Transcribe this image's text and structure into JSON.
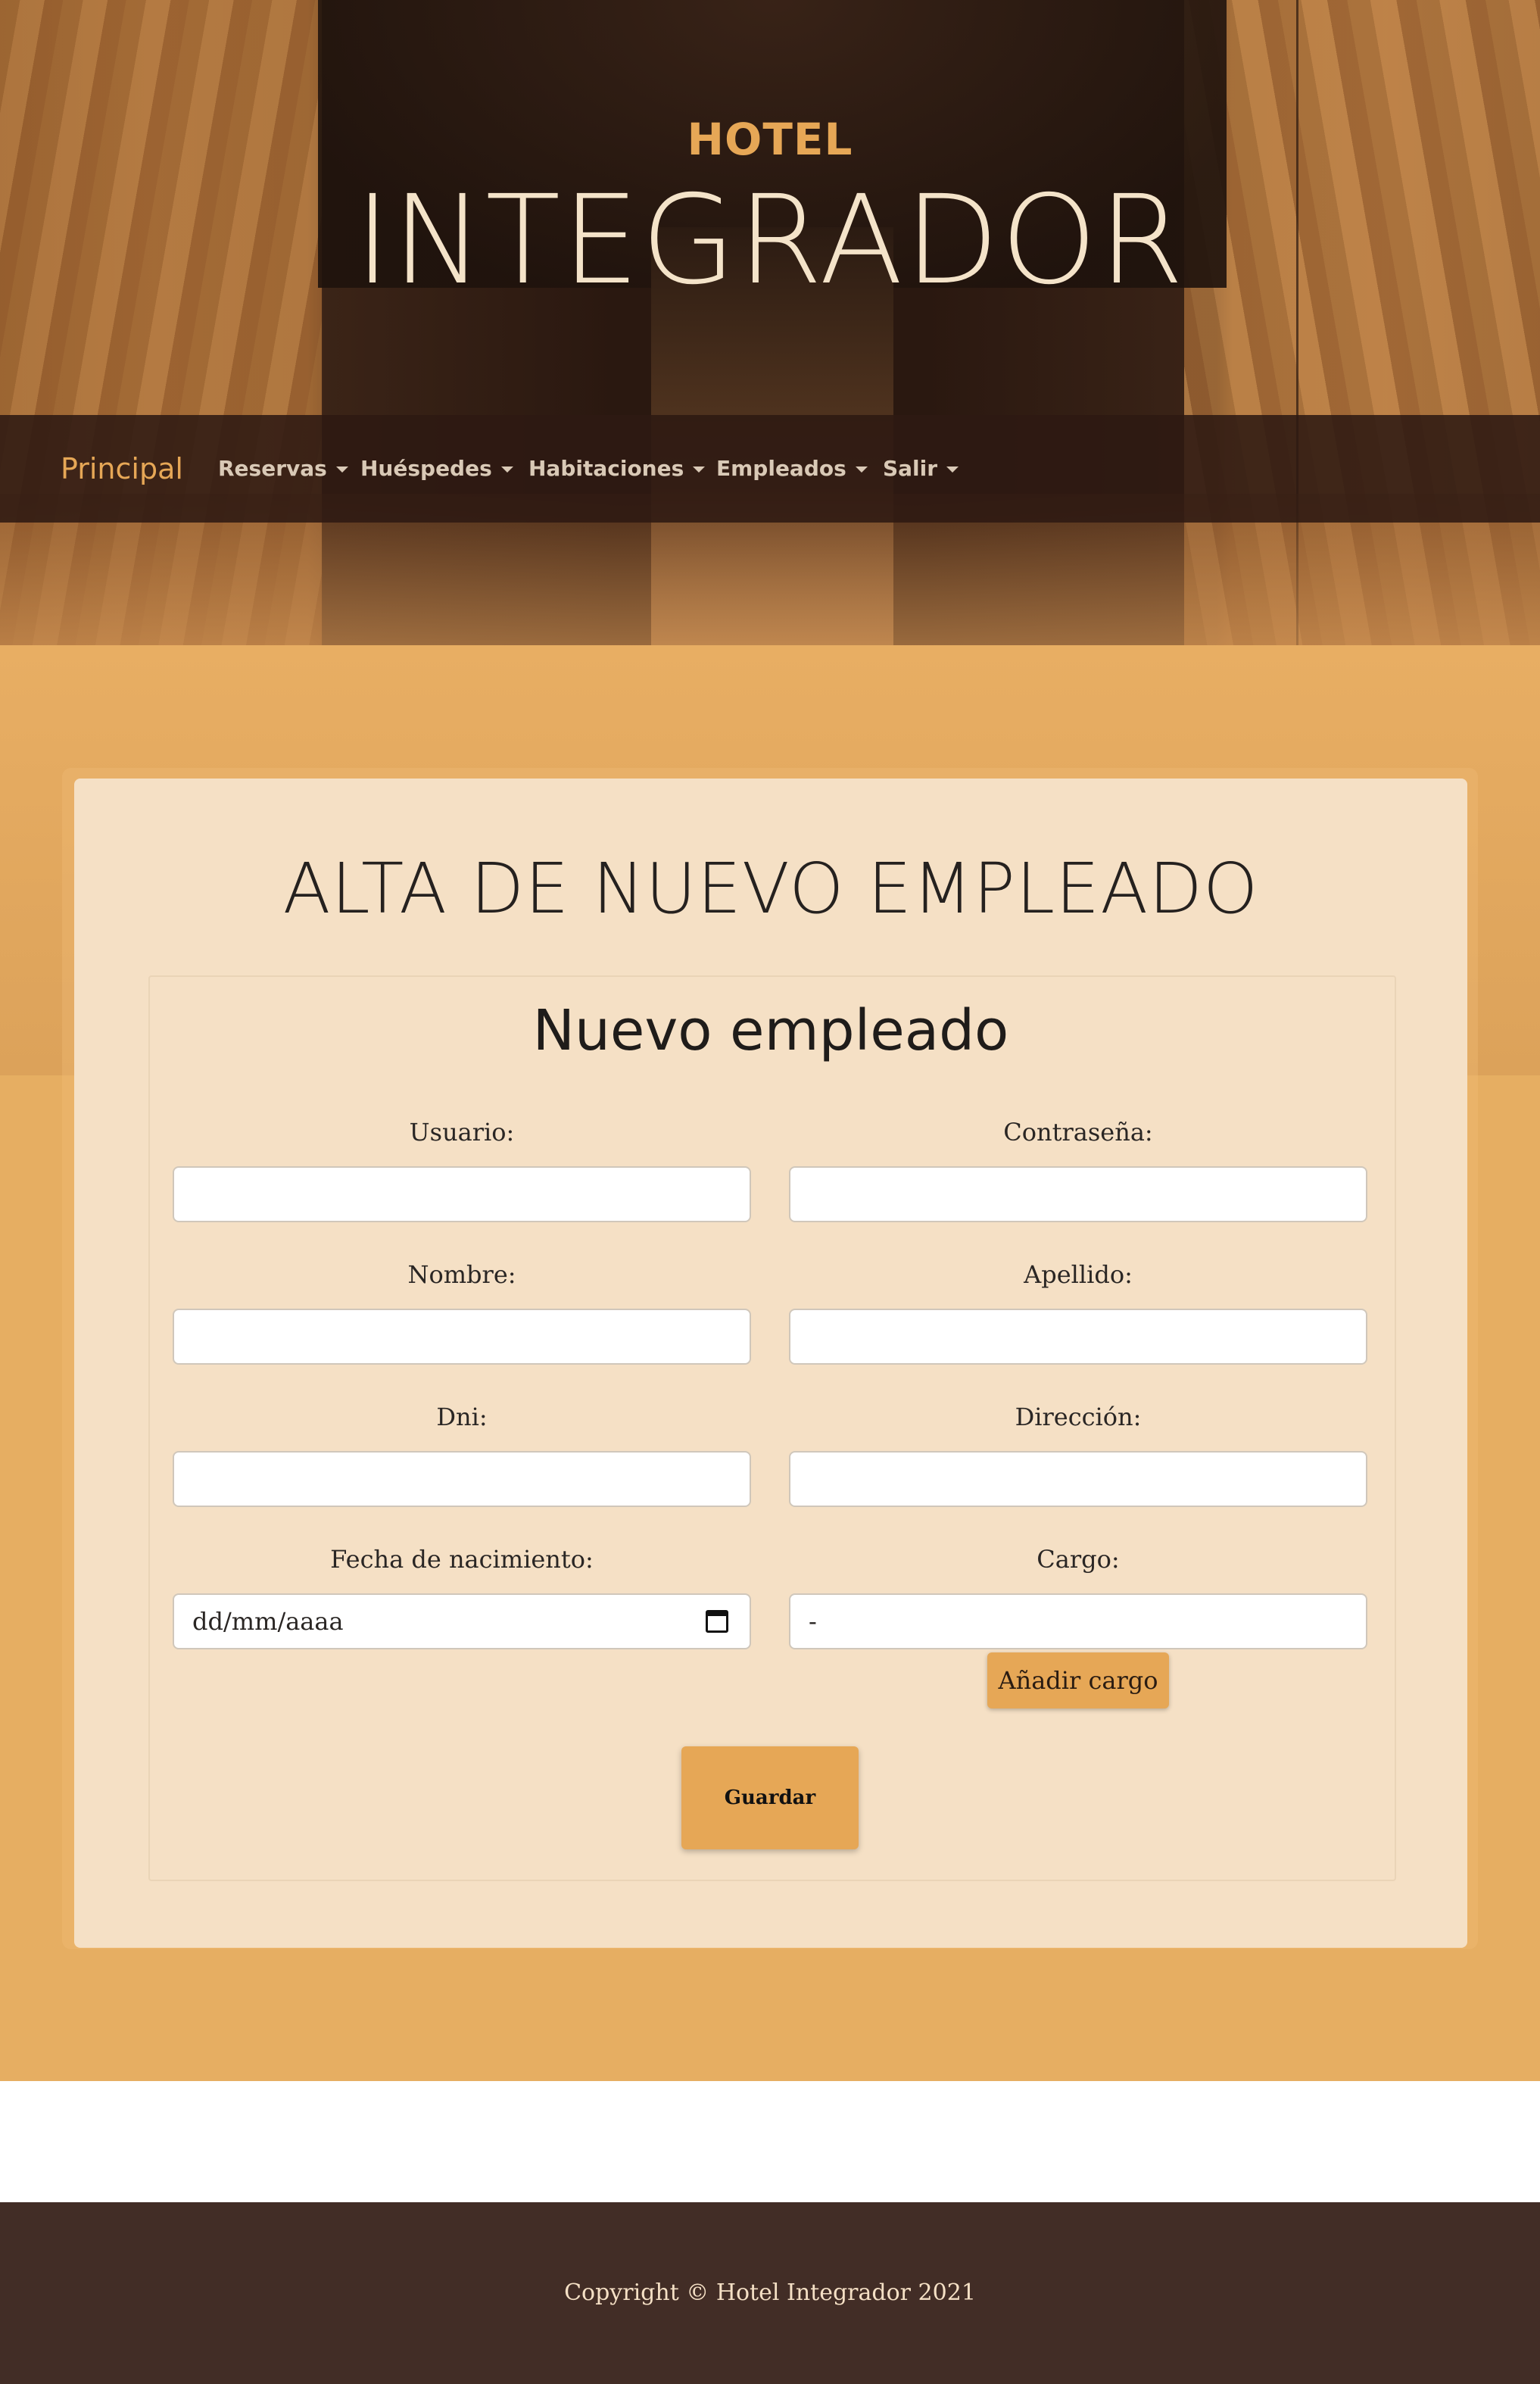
{
  "header": {
    "subtitle": "HOTEL",
    "title": "INTEGRADOR"
  },
  "nav": {
    "brand": "Principal",
    "items": [
      {
        "label": "Reservas"
      },
      {
        "label": "Huéspedes"
      },
      {
        "label": "Habitaciones"
      },
      {
        "label": "Empleados"
      },
      {
        "label": "Salir"
      }
    ]
  },
  "page": {
    "heading": "ALTA DE NUEVO EMPLEADO",
    "form_title": "Nuevo empleado"
  },
  "form": {
    "usuario_label": "Usuario:",
    "usuario_value": "",
    "contrasena_label": "Contraseña:",
    "contrasena_value": "",
    "nombre_label": "Nombre:",
    "nombre_value": "",
    "apellido_label": "Apellido:",
    "apellido_value": "",
    "dni_label": "Dni:",
    "dni_value": "",
    "direccion_label": "Dirección:",
    "direccion_value": "",
    "fecha_label": "Fecha de nacimiento:",
    "fecha_placeholder": "dd/mm/aaaa",
    "cargo_label": "Cargo:",
    "cargo_selected": "-",
    "add_cargo_button": "Añadir cargo",
    "save_button": "Guardar"
  },
  "footer": {
    "copyright": "Copyright © Hotel Integrador 2021"
  },
  "colors": {
    "accent": "#e6a756",
    "nav_bg": "#2d1912",
    "card_bg": "#f5e0c5",
    "footer_bg": "#422d26"
  }
}
